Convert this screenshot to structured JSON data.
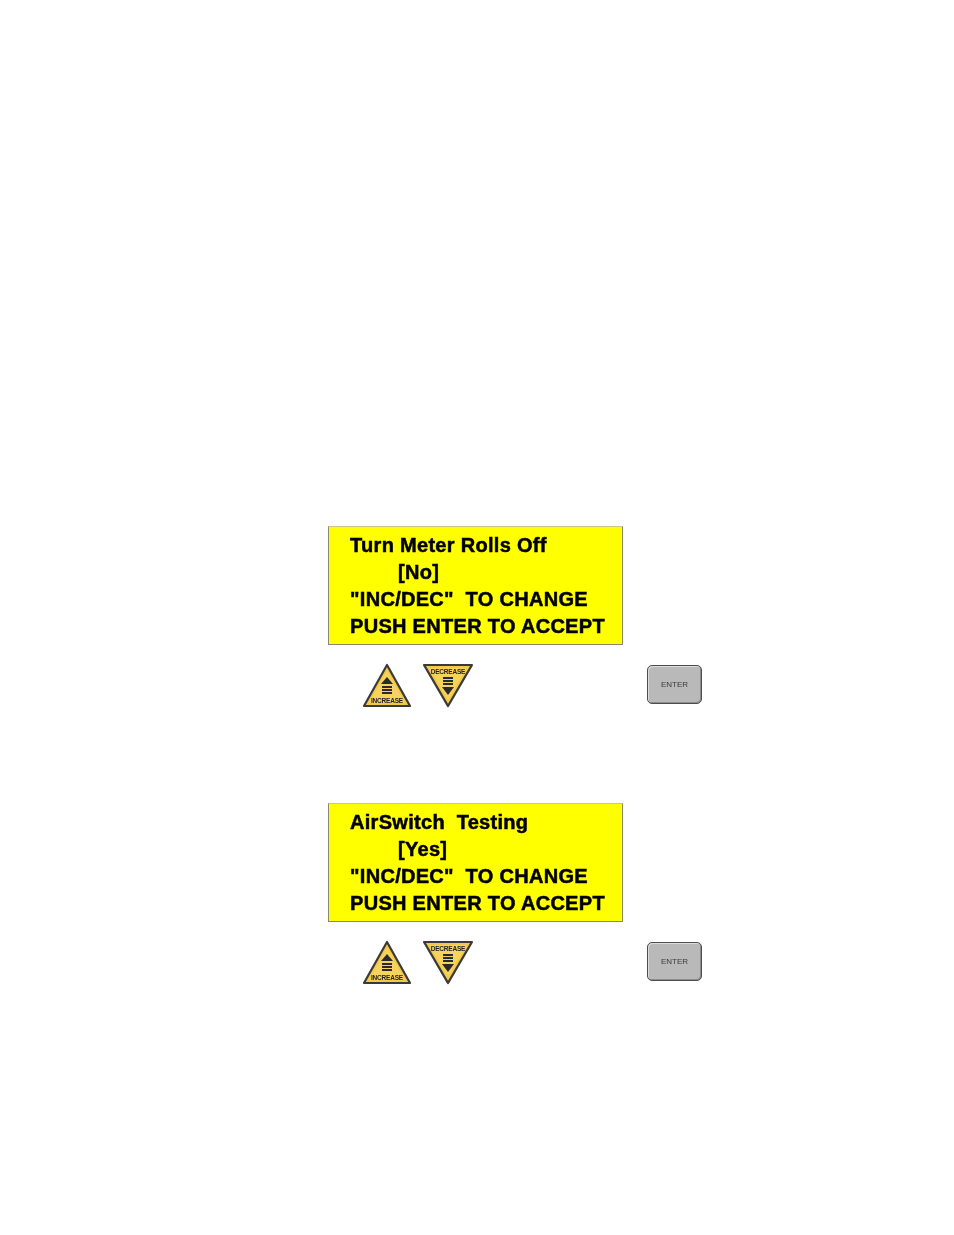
{
  "screens": [
    {
      "display": {
        "title": "Turn Meter Rolls Off",
        "value": "[No]",
        "instructions": [
          "\"INC/DEC\"  TO CHANGE",
          "PUSH ENTER TO ACCEPT"
        ]
      },
      "keys": [
        {
          "kind": "increase",
          "label": "INCREASE"
        },
        {
          "kind": "decrease",
          "label": "DECREASE"
        },
        {
          "kind": "enter",
          "label": "ENTER"
        }
      ]
    },
    {
      "display": {
        "title": "AirSwitch  Testing",
        "value": "[Yes]",
        "instructions": [
          "\"INC/DEC\"  TO CHANGE",
          "PUSH ENTER TO ACCEPT"
        ]
      },
      "keys": [
        {
          "kind": "increase",
          "label": "INCREASE"
        },
        {
          "kind": "decrease",
          "label": "DECREASE"
        },
        {
          "kind": "enter",
          "label": "ENTER"
        }
      ]
    }
  ]
}
